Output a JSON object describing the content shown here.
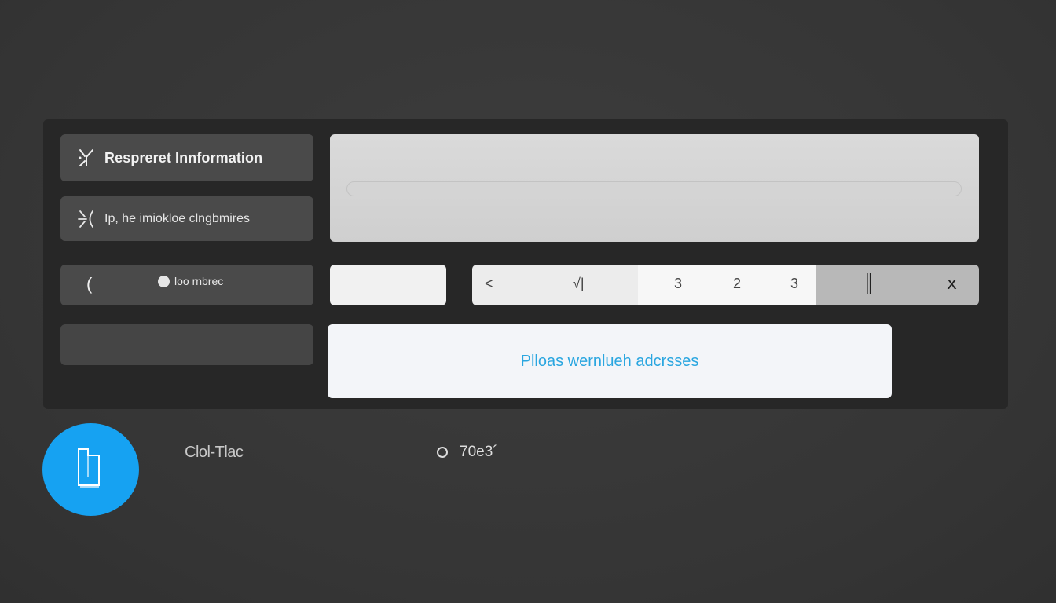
{
  "sidebar": {
    "items": [
      {
        "label": "Respreret Innformation",
        "icon": "branch-icon"
      },
      {
        "label": "Ip, he imiokloe clngbmires",
        "icon": "branch-icon"
      },
      {
        "label": "loo rnbrec",
        "back_glyph": "(",
        "icon": "dot-icon"
      },
      {
        "label": ""
      }
    ]
  },
  "pager": {
    "prev": "<",
    "left_mark": "√|",
    "pages": [
      "3",
      "2",
      "3"
    ],
    "right_marks": [
      "║",
      "ⅹ"
    ]
  },
  "cta": {
    "label": "Plloas wernlueh adcrsses"
  },
  "footer": {
    "left_text": "Clol-Tlac",
    "right_text": "70e3´"
  },
  "colors": {
    "accent": "#16a2f2",
    "cta_text": "#2aa6e0",
    "panel": "#272727",
    "background": "#383838"
  }
}
